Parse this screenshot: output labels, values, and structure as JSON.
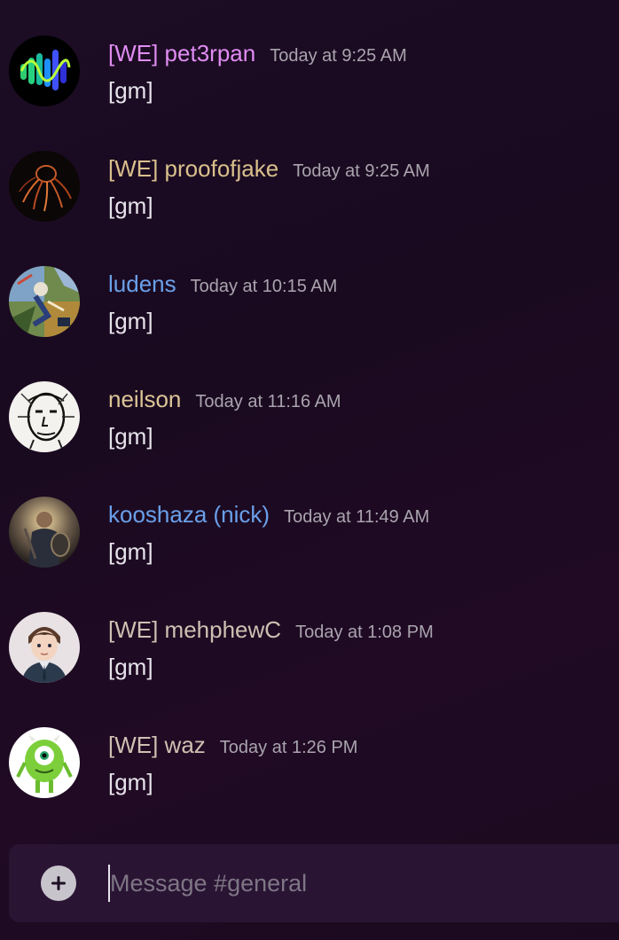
{
  "messages": [
    {
      "username": "[WE] pet3rpan",
      "timestamp": "Today at 9:25 AM",
      "content": "[gm]",
      "name_color": "#e08cf2"
    },
    {
      "username": "[WE] proofofjake",
      "timestamp": "Today at 9:25 AM",
      "content": "[gm]",
      "name_color": "#d9c08c"
    },
    {
      "username": "ludens",
      "timestamp": "Today at 10:15 AM",
      "content": "[gm]",
      "name_color": "#6aa0ea"
    },
    {
      "username": "neilson",
      "timestamp": "Today at 11:16 AM",
      "content": "[gm]",
      "name_color": "#dcc596"
    },
    {
      "username": "kooshaza (nick)",
      "timestamp": "Today at 11:49 AM",
      "content": "[gm]",
      "name_color": "#6aa0ea"
    },
    {
      "username": "[WE] mehphewC",
      "timestamp": "Today at 1:08 PM",
      "content": "[gm]",
      "name_color": "#cfc0b2"
    },
    {
      "username": "[WE] waz",
      "timestamp": "Today at 1:26 PM",
      "content": "[gm]",
      "name_color": "#cfc0b2"
    }
  ],
  "composer": {
    "placeholder": "Message #general",
    "value": ""
  },
  "icons": {
    "add": "plus-circle-icon"
  }
}
